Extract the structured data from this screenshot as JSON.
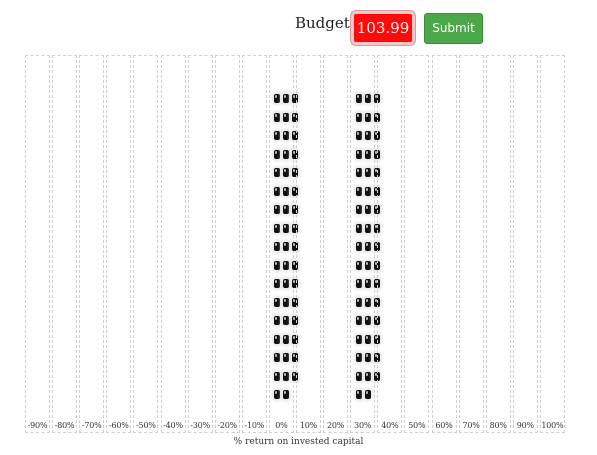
{
  "header": {
    "budget_label": "Budget:",
    "budget_value": "103.99",
    "submit_label": "Submit"
  },
  "colors": {
    "budget_bg": "#ff0a0a",
    "submit_bg": "#4ca74a",
    "token": "#111111"
  },
  "chart_data": {
    "type": "bar",
    "xlabel": "% return on invested capital",
    "categories": [
      "-90%",
      "-80%",
      "-70%",
      "-60%",
      "-50%",
      "-40%",
      "-30%",
      "-20%",
      "-10%",
      "0%",
      "10%",
      "20%",
      "30%",
      "40%",
      "50%",
      "60%",
      "70%",
      "80%",
      "90%",
      "100%"
    ],
    "full_stacks": [
      {
        "category": "0%",
        "full_rows": 16,
        "last_row_tokens": 2,
        "tokens_per_row": 3
      },
      {
        "category": "30%",
        "full_rows": 16,
        "last_row_tokens": 2,
        "tokens_per_row": 3
      }
    ],
    "values": [
      0,
      0,
      0,
      0,
      0,
      0,
      0,
      0,
      0,
      50,
      0,
      0,
      50,
      0,
      0,
      0,
      0,
      0,
      0,
      0
    ],
    "grid": true
  }
}
